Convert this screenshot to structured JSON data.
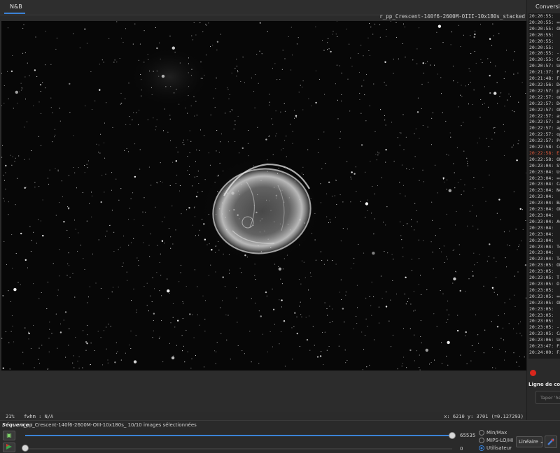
{
  "tabs": {
    "active": "N&B"
  },
  "image": {
    "filename": "r_pp_Crescent-140f6-2600M-OIII-10x180s_stacked"
  },
  "status": {
    "zoom": "21%",
    "fwhm": "fwhm : N/A",
    "coords": "x: 6210  y: 3701  (=0.127293)"
  },
  "sequence": {
    "label": "Séquence :",
    "value": "r_pp_Crescent-140f6-2600M-OIII-10x180s_  10/10 images sélectionnées"
  },
  "sliders": {
    "max_value": "65535",
    "min_value": "0"
  },
  "display_modes": {
    "items": [
      "Min/Max",
      "MIPS-LO/HI",
      "Utilisateur"
    ],
    "selected": "Utilisateur"
  },
  "scale": {
    "selected": "Linéaire"
  },
  "right_panel": {
    "tab": "Conversion",
    "command_label": "Ligne de comm",
    "command_placeholder": "Taper 'help'",
    "log": [
      "20:20:55:",
      "20:20:55: ==",
      "20:20:55: OB",
      "20:20:55:",
      "20:20:55:",
      "20:20:55:",
      "20:20:55: -",
      "20:20:55: Ca",
      "20:20:57: Un",
      "20:21:37: Fi",
      "20:21:48: Fi",
      "20:22:56: De",
      "20:22:57: pl",
      "20:22:57: om",
      "20:22:57: De",
      "20:22:57: OB",
      "20:22:57: as",
      "20:22:57: as",
      "20:22:57: ap",
      "20:22:57: op",
      "20:22:57: Pu",
      "20:22:58: Co",
      "20:22:58: Er",
      "20:22:58: OB",
      "20:23:04: St",
      "20:23:04: Us",
      "20:23:04: ==",
      "20:23:04: Ca",
      "20:23:04: No",
      "20:23:04:",
      "20:23:04: Ba",
      "20:23:04: OB",
      "20:23:04:",
      "20:23:04: Au",
      "20:23:04:",
      "20:23:04:",
      "20:23:04:",
      "20:23:04: Te",
      "20:23:04:",
      "20:23:04: Te",
      "20:23:05: OB",
      "20:23:05:",
      "20:23:05: T",
      "20:23:05: O",
      "20:23:05:",
      "20:23:05: ==",
      "20:23:05: OB",
      "20:23:05:",
      "20:23:05:",
      "20:23:05:",
      "20:23:05: -",
      "20:23:05: Ca",
      "20:23:06: Un",
      "20:23:47: Fi",
      "20:24:00: Fi"
    ]
  }
}
